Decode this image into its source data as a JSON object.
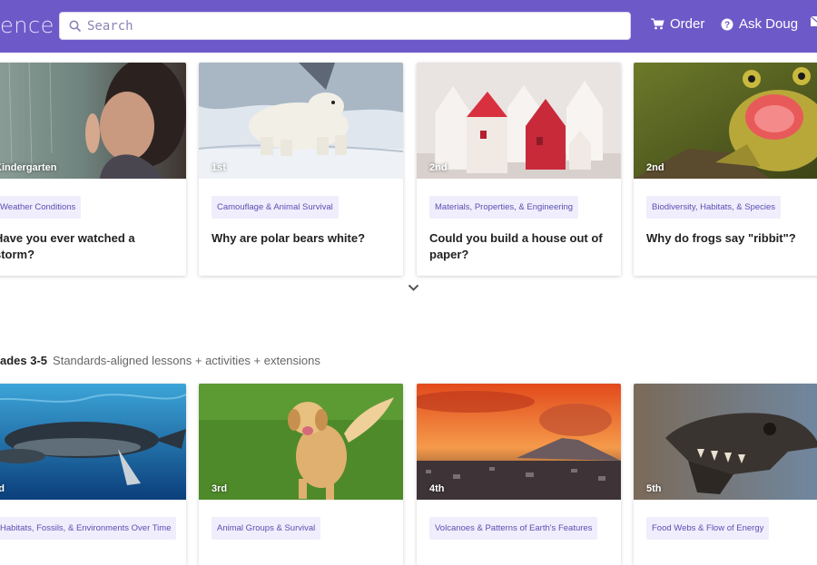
{
  "header": {
    "logo_text": "ence",
    "search_placeholder": "Search",
    "nav": {
      "order": "Order",
      "ask": "Ask Doug"
    }
  },
  "row1": [
    {
      "grade": "Kindergarten",
      "tag": "Weather Conditions",
      "title": "Have you ever watched a storm?"
    },
    {
      "grade": "1st",
      "tag": "Camouflage & Animal Survival",
      "title": "Why are polar bears white?"
    },
    {
      "grade": "2nd",
      "tag": "Materials, Properties, & Engineering",
      "title": "Could you build a house out of paper?"
    },
    {
      "grade": "2nd",
      "tag": "Biodiversity, Habitats, & Species",
      "title": "Why do frogs say \"ribbit\"?"
    }
  ],
  "section2": {
    "title": "ades 3-5",
    "subtitle": "Standards-aligned lessons + activities + extensions"
  },
  "row2": [
    {
      "grade": "rd",
      "tag": "Habitats, Fossils, & Environments Over Time"
    },
    {
      "grade": "3rd",
      "tag": "Animal Groups & Survival"
    },
    {
      "grade": "4th",
      "tag": "Volcanoes & Patterns of Earth's Features"
    },
    {
      "grade": "5th",
      "tag": "Food Webs & Flow of Energy"
    }
  ],
  "colors": {
    "header": "#6d5ac8",
    "tag_bg": "#f0eefc",
    "tag_text": "#5a4fb2"
  },
  "icons": [
    "search-icon",
    "cart-icon",
    "question-icon",
    "mail-icon",
    "chevron-down-icon"
  ]
}
